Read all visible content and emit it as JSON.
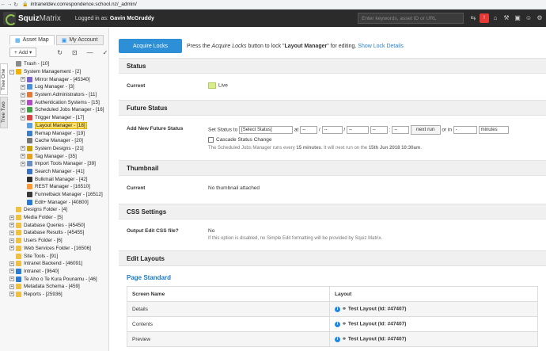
{
  "browser": {
    "url": "intranetdev.correspondence.school.nz/_admin/"
  },
  "topbar": {
    "brand_bold": "Squiz",
    "brand_light": "Matrix",
    "logged_prefix": "Logged in as:",
    "user": "Gavin McGruddy",
    "search_placeholder": "Enter keywords, asset ID or URL"
  },
  "sidebar": {
    "tabs": [
      "Asset Map",
      "My Account"
    ],
    "vtabs": [
      "Tree One",
      "Tree Two"
    ],
    "add_label": "Add",
    "tree": [
      {
        "label": "Trash - [10]",
        "level": 0,
        "exp": "",
        "color": "#8a8a8a"
      },
      {
        "label": "System Management - [2]",
        "level": 0,
        "exp": "-",
        "color": "#f0b400"
      },
      {
        "label": "Mirror Manager - [45340]",
        "level": 1,
        "exp": "+",
        "color": "#7b61c9"
      },
      {
        "label": "Log Manager - [3]",
        "level": 1,
        "exp": "+",
        "color": "#4a8fd8"
      },
      {
        "label": "System Administrators - [11]",
        "level": 1,
        "exp": "+",
        "color": "#e07b39"
      },
      {
        "label": "Authentication Systems - [15]",
        "level": 1,
        "exp": "+",
        "color": "#b04ec2"
      },
      {
        "label": "Scheduled Jobs Manager - [16]",
        "level": 1,
        "exp": "+",
        "color": "#44a048"
      },
      {
        "label": "Trigger Manager - [17]",
        "level": 1,
        "exp": "+",
        "color": "#d84343"
      },
      {
        "label": "Layout Manager - [18]",
        "level": 1,
        "exp": "",
        "color": "#5aa0e0",
        "selected": true
      },
      {
        "label": "Remap Manager - [19]",
        "level": 1,
        "exp": "",
        "color": "#3f7fc8"
      },
      {
        "label": "Cache Manager - [20]",
        "level": 1,
        "exp": "",
        "color": "#777777"
      },
      {
        "label": "System Designs - [21]",
        "level": 1,
        "exp": "+",
        "color": "#c9a200"
      },
      {
        "label": "Tag Manager - [35]",
        "level": 1,
        "exp": "+",
        "color": "#e8a020"
      },
      {
        "label": "Import Tools Manager - [39]",
        "level": 1,
        "exp": "+",
        "color": "#6c8ebf"
      },
      {
        "label": "Search Manager - [41]",
        "level": 1,
        "exp": "",
        "color": "#3b74c4"
      },
      {
        "label": "Bulkmail Manager - [42]",
        "level": 1,
        "exp": "",
        "color": "#2f2f2f"
      },
      {
        "label": "REST Manager - [16510]",
        "level": 1,
        "exp": "",
        "color": "#ff9933"
      },
      {
        "label": "Funnelback Manager - [16512]",
        "level": 1,
        "exp": "",
        "color": "#3a3a3a"
      },
      {
        "label": "Edit+ Manager - [40800]",
        "level": 1,
        "exp": "",
        "color": "#2b7bd1"
      },
      {
        "label": "Designs Folder - [4]",
        "level": 0,
        "exp": "",
        "color": "#f0c040"
      },
      {
        "label": "Media Folder - [5]",
        "level": 0,
        "exp": "+",
        "color": "#f0c040"
      },
      {
        "label": "Database Queries - [45450]",
        "level": 0,
        "exp": "+",
        "color": "#f0c040"
      },
      {
        "label": "Database Results - [45455]",
        "level": 0,
        "exp": "+",
        "color": "#f0c040"
      },
      {
        "label": "Users Folder - [6]",
        "level": 0,
        "exp": "+",
        "color": "#f0c040"
      },
      {
        "label": "Web Services Folder - [16506]",
        "level": 0,
        "exp": "+",
        "color": "#f0c040"
      },
      {
        "label": "Site Tools - [91]",
        "level": 0,
        "exp": "",
        "color": "#f0c040"
      },
      {
        "label": "Intranet Backend - [46091]",
        "level": 0,
        "exp": "+",
        "color": "#f0c040"
      },
      {
        "label": "Intranet - [9640]",
        "level": 0,
        "exp": "+",
        "color": "#2b7bd1"
      },
      {
        "label": "Te Aho o Te Kura Pounamu - [46]",
        "level": 0,
        "exp": "+",
        "color": "#2b7bd1"
      },
      {
        "label": "Metadata Schema - [459]",
        "level": 0,
        "exp": "+",
        "color": "#f0c040"
      },
      {
        "label": "Reports - [25936]",
        "level": 0,
        "exp": "+",
        "color": "#f0c040"
      }
    ]
  },
  "lock": {
    "button": "Acquire Locks",
    "text_pre": "Press the",
    "text_em": "Acquire Locks",
    "text_mid": "button to lock \"",
    "text_asset": "Layout Manager",
    "text_post": "\" for editing.",
    "details_link": "Show Lock Details"
  },
  "status": {
    "heading": "Status",
    "current_label": "Current",
    "current_value": "Live"
  },
  "future": {
    "heading": "Future Status",
    "label": "Add New Future Status",
    "set_status_to": "Set Status to",
    "select_status": "[Select Status]",
    "at": "at",
    "dash": "--",
    "next_run": "next run",
    "or_in": "or in",
    "in_value": "-",
    "unit": "minutes",
    "cascade": "Cascade Status Change",
    "note_pre": "The Scheduled Jobs Manager runs every",
    "note_interval": "15 minutes",
    "note_mid": ". It will next run on the",
    "note_date": "15th Jun 2018 10:30am",
    "note_post": "."
  },
  "thumbnail": {
    "heading": "Thumbnail",
    "current_label": "Current",
    "current_value": "No thumbnail attached"
  },
  "css": {
    "heading": "CSS Settings",
    "label": "Output Edit CSS file?",
    "value": "No",
    "hint": "If this option is disabled, no Simple Edit formatting will be provided by Squiz Matrix."
  },
  "layouts": {
    "heading": "Edit Layouts",
    "subheading": "Page Standard",
    "col_screen": "Screen Name",
    "col_layout": "Layout",
    "rows": [
      {
        "screen": "Details",
        "layout": "Test Layout (Id: #47407)"
      },
      {
        "screen": "Contents",
        "layout": "Test Layout (Id: #47407)"
      },
      {
        "screen": "Preview",
        "layout": "Test Layout (Id: #47407)"
      }
    ]
  }
}
